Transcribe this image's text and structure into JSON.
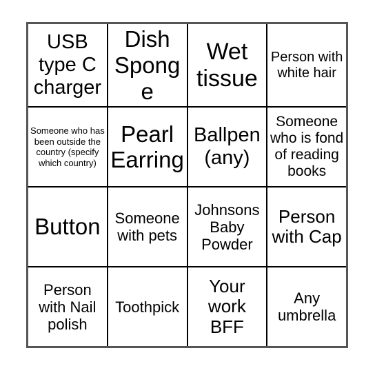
{
  "card": {
    "type": "bingo-card",
    "columns": 4,
    "rows": 4,
    "border_color": "#555555",
    "gridline_color": "#000000",
    "background_color": "#ffffff",
    "text_color": "#000000",
    "cells": [
      [
        {
          "text": "USB type C charger",
          "size": "xl"
        },
        {
          "text": "Dish Sponge",
          "size": "xxl"
        },
        {
          "text": "Wet tissue",
          "size": "huge"
        },
        {
          "text": "Person with white hair",
          "size": "sm"
        }
      ],
      [
        {
          "text": "Someone who has been outside the country (specify which country)",
          "size": "xs"
        },
        {
          "text": "Pearl Earring",
          "size": "xxl"
        },
        {
          "text": "Ballpen (any)",
          "size": "xl"
        },
        {
          "text": "Someone who is fond of reading books",
          "size": "smb"
        }
      ],
      [
        {
          "text": "Button",
          "size": "xxl"
        },
        {
          "text": "Someone with pets",
          "size": "md"
        },
        {
          "text": "Johnsons Baby Powder",
          "size": "md"
        },
        {
          "text": "Person with Cap",
          "size": "lg"
        }
      ],
      [
        {
          "text": "Person with Nail polish",
          "size": "md"
        },
        {
          "text": "Toothpick",
          "size": "md"
        },
        {
          "text": "Your work BFF",
          "size": "lg"
        },
        {
          "text": "Any umbrella",
          "size": "md"
        }
      ]
    ]
  }
}
